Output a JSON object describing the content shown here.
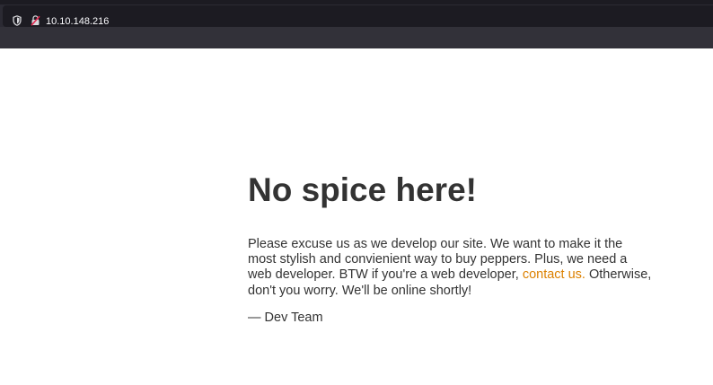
{
  "browser": {
    "url": "10.10.148.216",
    "colors": {
      "toolbar": "#2b2a33",
      "urlbar": "#1c1b22",
      "url_text": "#fbfbfe",
      "insecure_icon": "#e22850"
    },
    "icons": [
      "shield-icon",
      "insecure-lock-icon"
    ]
  },
  "page": {
    "title": "No spice here!",
    "intro_before_link": "Please excuse us as we develop our site. We want to make it the most stylish and convienient way to buy peppers. Plus, we need a web developer. BTW if you're a web developer, ",
    "contact_link": "contact us.",
    "intro_after_link": " Otherwise, don't you worry. We'll be online shortly!",
    "signoff": "— Dev Team",
    "colors": {
      "text": "#333333",
      "link": "#dc8100",
      "background": "#ffffff"
    }
  }
}
